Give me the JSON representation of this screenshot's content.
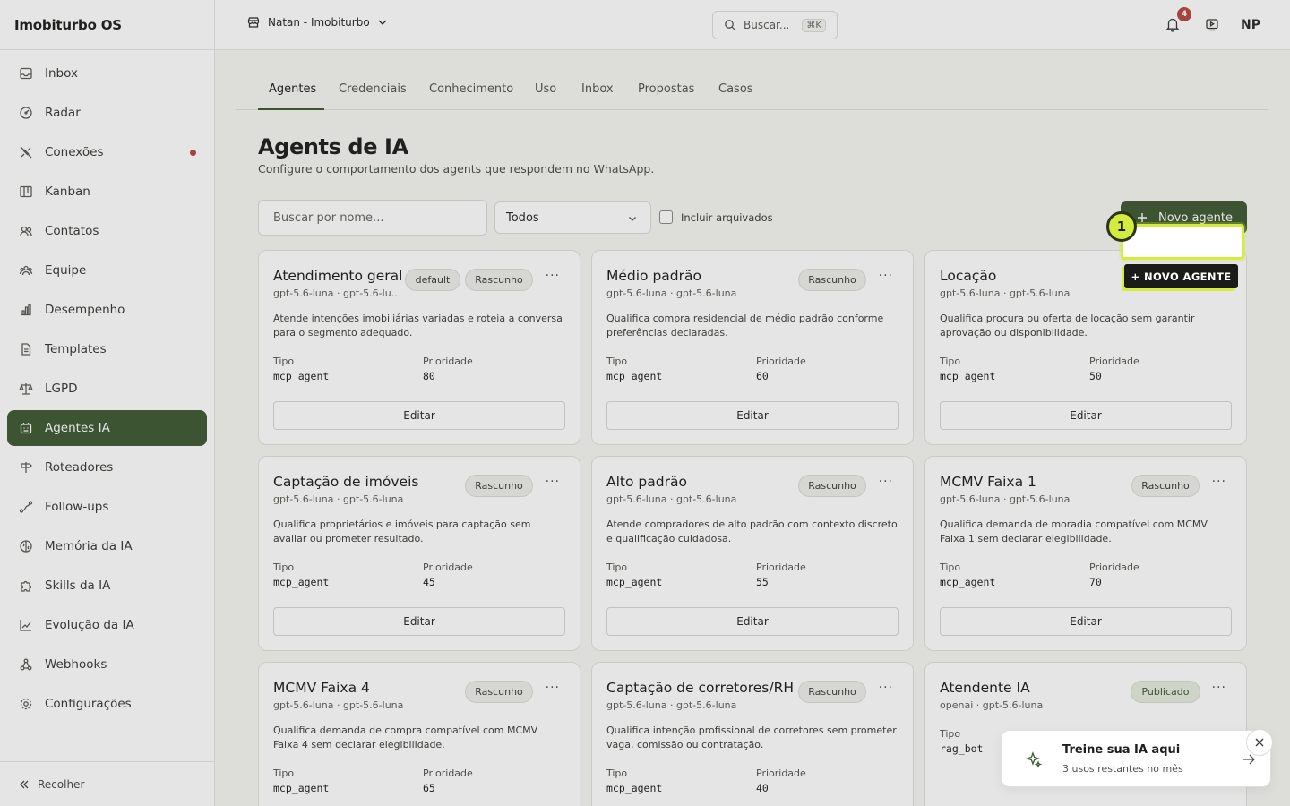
{
  "app": {
    "brand": "Imobiturbo OS"
  },
  "sidebar": {
    "items": [
      {
        "label": "Inbox",
        "icon": "inbox-icon"
      },
      {
        "label": "Radar",
        "icon": "radar-icon"
      },
      {
        "label": "Conexões",
        "icon": "connections-icon",
        "dot": true
      },
      {
        "label": "Kanban",
        "icon": "kanban-icon"
      },
      {
        "label": "Contatos",
        "icon": "contacts-icon"
      },
      {
        "label": "Equipe",
        "icon": "team-icon"
      },
      {
        "label": "Desempenho",
        "icon": "bar-chart-icon"
      },
      {
        "label": "Templates",
        "icon": "template-icon"
      },
      {
        "label": "LGPD",
        "icon": "scale-icon"
      },
      {
        "label": "Agentes IA",
        "icon": "bot-icon",
        "active": true
      },
      {
        "label": "Roteadores",
        "icon": "router-icon"
      },
      {
        "label": "Follow-ups",
        "icon": "route-icon"
      },
      {
        "label": "Memória da IA",
        "icon": "brain-icon"
      },
      {
        "label": "Skills da IA",
        "icon": "puzzle-icon"
      },
      {
        "label": "Evolução da IA",
        "icon": "trend-icon"
      },
      {
        "label": "Webhooks",
        "icon": "webhook-icon"
      },
      {
        "label": "Configurações",
        "icon": "gear-icon"
      }
    ],
    "collapse_label": "Recolher"
  },
  "topbar": {
    "workspace": "Natan - Imobiturbo",
    "search_placeholder": "Buscar...",
    "search_shortcut": "⌘K",
    "notifications_count": "4",
    "avatar_initials": "NP"
  },
  "tabs": [
    {
      "label": "Agentes",
      "active": true
    },
    {
      "label": "Credenciais"
    },
    {
      "label": "Conhecimento"
    },
    {
      "label": "Uso"
    },
    {
      "label": "Inbox"
    },
    {
      "label": "Propostas"
    },
    {
      "label": "Casos"
    }
  ],
  "page": {
    "title": "Agents de IA",
    "subtitle": "Configure o comportamento dos agents que respondem no WhatsApp."
  },
  "filters": {
    "search_placeholder": "Buscar por nome...",
    "select_value": "Todos",
    "include_archived_label": "Incluir arquivados",
    "new_agent_label": "Novo agente"
  },
  "labels": {
    "tipo": "Tipo",
    "prioridade": "Prioridade",
    "editar": "Editar"
  },
  "agents": [
    {
      "name": "Atendimento geral",
      "model": "gpt-5.6-luna · gpt-5.6-lu...",
      "badges": [
        "default",
        "Rascunho"
      ],
      "desc": "Atende intenções imobiliárias variadas e roteia a conversa para o segmento adequado.",
      "tipo": "mcp_agent",
      "prioridade": "80"
    },
    {
      "name": "Médio padrão",
      "model": "gpt-5.6-luna · gpt-5.6-luna",
      "badges": [
        "Rascunho"
      ],
      "desc": "Qualifica compra residencial de médio padrão conforme preferências declaradas.",
      "tipo": "mcp_agent",
      "prioridade": "60"
    },
    {
      "name": "Locação",
      "model": "gpt-5.6-luna · gpt-5.6-luna",
      "badges": [],
      "desc": "Qualifica procura ou oferta de locação sem garantir aprovação ou disponibilidade.",
      "tipo": "mcp_agent",
      "prioridade": "50"
    },
    {
      "name": "Captação de imóveis",
      "model": "gpt-5.6-luna · gpt-5.6-luna",
      "badges": [
        "Rascunho"
      ],
      "desc": "Qualifica proprietários e imóveis para captação sem avaliar ou prometer resultado.",
      "tipo": "mcp_agent",
      "prioridade": "45"
    },
    {
      "name": "Alto padrão",
      "model": "gpt-5.6-luna · gpt-5.6-luna",
      "badges": [
        "Rascunho"
      ],
      "desc": "Atende compradores de alto padrão com contexto discreto e qualificação cuidadosa.",
      "tipo": "mcp_agent",
      "prioridade": "55"
    },
    {
      "name": "MCMV Faixa 1",
      "model": "gpt-5.6-luna · gpt-5.6-luna",
      "badges": [
        "Rascunho"
      ],
      "desc": "Qualifica demanda de moradia compatível com MCMV Faixa 1 sem declarar elegibilidade.",
      "tipo": "mcp_agent",
      "prioridade": "70"
    },
    {
      "name": "MCMV Faixa 4",
      "model": "gpt-5.6-luna · gpt-5.6-luna",
      "badges": [
        "Rascunho"
      ],
      "desc": "Qualifica demanda de compra compatível com MCMV Faixa 4 sem declarar elegibilidade.",
      "tipo": "mcp_agent",
      "prioridade": "65"
    },
    {
      "name": "Captação de corretores/RH",
      "model": "gpt-5.6-luna · gpt-5.6-luna",
      "badges": [
        "Rascunho"
      ],
      "desc": "Qualifica intenção profissional de corretores sem prometer vaga, comissão ou contratação.",
      "tipo": "mcp_agent",
      "prioridade": "40"
    },
    {
      "name": "Atendente IA",
      "model": "openai · gpt-5.6-luna",
      "badges": [
        "Publicado"
      ],
      "desc": "",
      "tipo": "rag_bot",
      "prioridade": ""
    }
  ],
  "tutorial": {
    "step": "1",
    "tag": "+ NOVO AGENTE"
  },
  "toast": {
    "title": "Treine sua IA aqui",
    "subtitle": "3 usos restantes no mês"
  },
  "colors": {
    "accent": "#3f5a33",
    "highlight": "#d4ec3c",
    "danger": "#b5483f"
  }
}
